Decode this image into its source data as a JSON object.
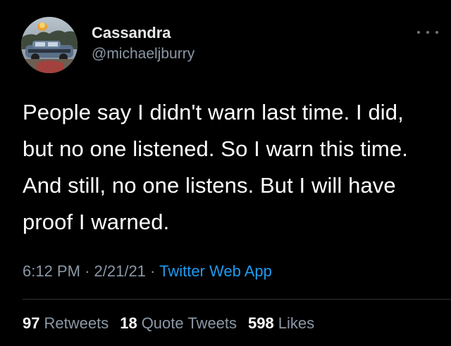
{
  "author": {
    "display_name": "Cassandra",
    "handle": "@michaeljburry",
    "avatar_icon": "profile-photo-avatar"
  },
  "tweet": {
    "text": "People say I didn't warn last time. I did,\nbut no one listened. So I warn this time.\nAnd still, no one listens. But I will have\nproof I warned.",
    "time": "6:12 PM",
    "separator": "·",
    "date": "2/21/21",
    "source": "Twitter Web App"
  },
  "stats": {
    "retweets_count": "97",
    "retweets_label": "Retweets",
    "quote_tweets_count": "18",
    "quote_tweets_label": "Quote Tweets",
    "likes_count": "598",
    "likes_label": "Likes"
  },
  "icons": {
    "more": "more-options-icon"
  },
  "colors": {
    "background": "#000000",
    "primary_text": "#ffffff",
    "secondary_text": "#8b98a5",
    "link": "#1d9bf0",
    "divider": "#2f3336"
  }
}
